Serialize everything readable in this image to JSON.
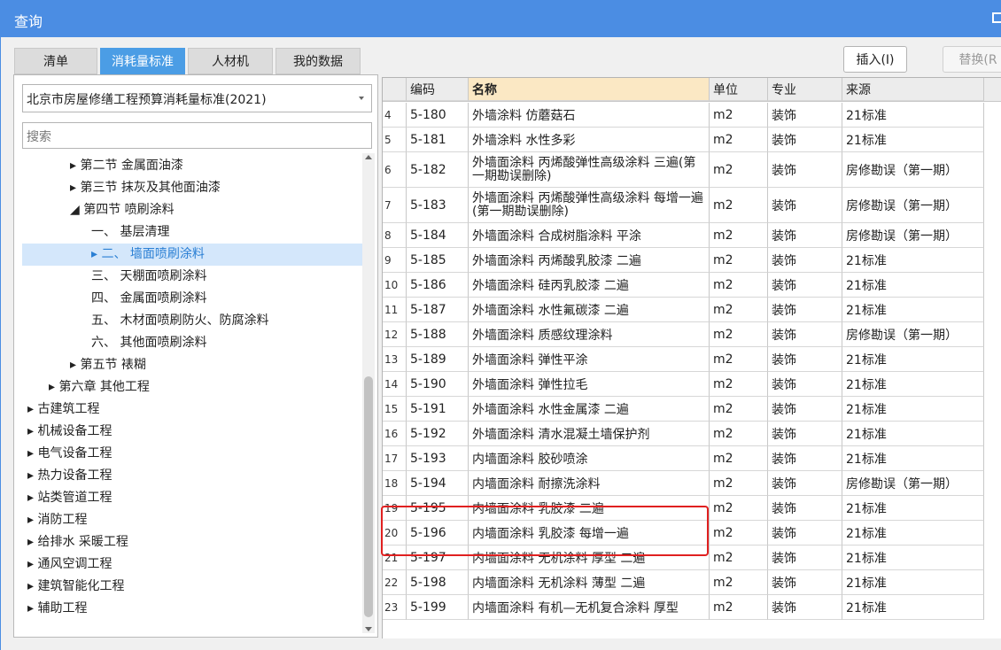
{
  "window": {
    "title": "查询"
  },
  "tabs": [
    "清单",
    "消耗量标准",
    "人材机",
    "我的数据"
  ],
  "left": {
    "select_value": "北京市房屋修缮工程预算消耗量标准(2021)",
    "search_placeholder": "搜索",
    "tree": [
      {
        "label": "▸  第二节 金属面油漆",
        "indent": 2
      },
      {
        "label": "▸  第三节 抹灰及其他面油漆",
        "indent": 2
      },
      {
        "label": "◢  第四节 喷刷涂料",
        "indent": 2
      },
      {
        "label": "一、 基层清理",
        "indent": 3
      },
      {
        "label": "▸  二、 墙面喷刷涂料",
        "indent": 3,
        "selected": true
      },
      {
        "label": "三、 天棚面喷刷涂料",
        "indent": 3
      },
      {
        "label": "四、 金属面喷刷涂料",
        "indent": 3
      },
      {
        "label": "五、 木材面喷刷防火、防腐涂料",
        "indent": 3
      },
      {
        "label": "六、 其他面喷刷涂料",
        "indent": 3
      },
      {
        "label": "▸  第五节 裱糊",
        "indent": 2
      },
      {
        "label": "▸  第六章 其他工程",
        "indent": 1
      },
      {
        "label": "▸  古建筑工程",
        "indent": 0
      },
      {
        "label": "▸  机械设备工程",
        "indent": 0
      },
      {
        "label": "▸  电气设备工程",
        "indent": 0
      },
      {
        "label": "▸  热力设备工程",
        "indent": 0
      },
      {
        "label": "▸  站类管道工程",
        "indent": 0
      },
      {
        "label": "▸  消防工程",
        "indent": 0
      },
      {
        "label": "▸  给排水 采暖工程",
        "indent": 0
      },
      {
        "label": "▸  通风空调工程",
        "indent": 0
      },
      {
        "label": "▸  建筑智能化工程",
        "indent": 0
      },
      {
        "label": "▸  辅助工程",
        "indent": 0
      }
    ]
  },
  "buttons": {
    "insert": "插入(I)",
    "replace": "替换(R"
  },
  "grid": {
    "columns": [
      "",
      "编码",
      "名称",
      "单位",
      "专业",
      "来源"
    ],
    "rows": [
      [
        "4",
        "5-180",
        "外墙涂料 仿蘑菇石",
        "m2",
        "装饰",
        "21标准"
      ],
      [
        "5",
        "5-181",
        "外墙涂料 水性多彩",
        "m2",
        "装饰",
        "21标准"
      ],
      [
        "6",
        "5-182",
        "外墙面涂料 丙烯酸弹性高级涂料 三遍(第一期勘误删除)",
        "m2",
        "装饰",
        "房修勘误（第一期）"
      ],
      [
        "7",
        "5-183",
        "外墙面涂料 丙烯酸弹性高级涂料 每增一遍(第一期勘误删除)",
        "m2",
        "装饰",
        "房修勘误（第一期）"
      ],
      [
        "8",
        "5-184",
        "外墙面涂料 合成树脂涂料 平涂",
        "m2",
        "装饰",
        "房修勘误（第一期）"
      ],
      [
        "9",
        "5-185",
        "外墙面涂料 丙烯酸乳胶漆 二遍",
        "m2",
        "装饰",
        "21标准"
      ],
      [
        "10",
        "5-186",
        "外墙面涂料 硅丙乳胶漆 二遍",
        "m2",
        "装饰",
        "21标准"
      ],
      [
        "11",
        "5-187",
        "外墙面涂料 水性氟碳漆 二遍",
        "m2",
        "装饰",
        "21标准"
      ],
      [
        "12",
        "5-188",
        "外墙面涂料 质感纹理涂料",
        "m2",
        "装饰",
        "房修勘误（第一期）"
      ],
      [
        "13",
        "5-189",
        "外墙面涂料 弹性平涂",
        "m2",
        "装饰",
        "21标准"
      ],
      [
        "14",
        "5-190",
        "外墙面涂料 弹性拉毛",
        "m2",
        "装饰",
        "21标准"
      ],
      [
        "15",
        "5-191",
        "外墙面涂料 水性金属漆 二遍",
        "m2",
        "装饰",
        "21标准"
      ],
      [
        "16",
        "5-192",
        "外墙面涂料 清水混凝土墙保护剂",
        "m2",
        "装饰",
        "21标准"
      ],
      [
        "17",
        "5-193",
        "内墙面涂料 胶砂喷涂",
        "m2",
        "装饰",
        "21标准"
      ],
      [
        "18",
        "5-194",
        "内墙面涂料 耐擦洗涂料",
        "m2",
        "装饰",
        "房修勘误（第一期）"
      ],
      [
        "19",
        "5-195",
        "内墙面涂料 乳胶漆 二遍",
        "m2",
        "装饰",
        "21标准"
      ],
      [
        "20",
        "5-196",
        "内墙面涂料 乳胶漆 每增一遍",
        "m2",
        "装饰",
        "21标准"
      ],
      [
        "21",
        "5-197",
        "内墙面涂料 无机涂料 厚型 二遍",
        "m2",
        "装饰",
        "21标准"
      ],
      [
        "22",
        "5-198",
        "内墙面涂料 无机涂料 薄型 二遍",
        "m2",
        "装饰",
        "21标准"
      ],
      [
        "23",
        "5-199",
        "内墙面涂料 有机—无机复合涂料 厚型",
        "m2",
        "装饰",
        "21标准"
      ]
    ]
  }
}
